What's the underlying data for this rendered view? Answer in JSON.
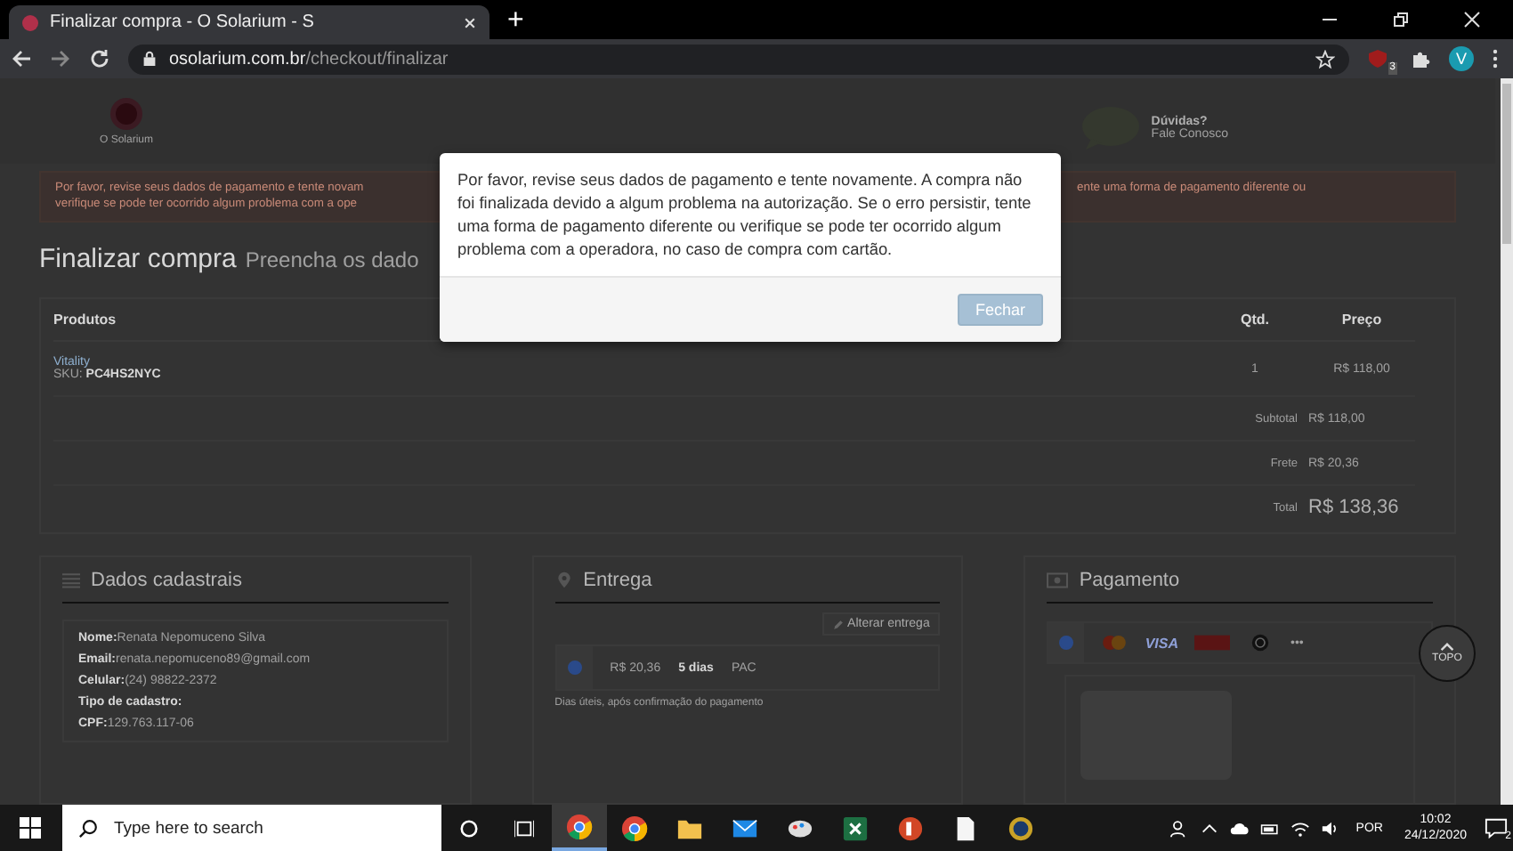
{
  "browser": {
    "tab": {
      "title": "Finalizar compra - O Solarium - S",
      "selected": true
    },
    "new_tab": "+",
    "url_domain": "osolarium.com.br",
    "url_path": "/checkout/finalizar",
    "extension_badge": "3",
    "profile": "V"
  },
  "header": {
    "logo_text": "O Solarium",
    "help_title": "Dúvidas?",
    "help_link": "Fale Conosco"
  },
  "alert": {
    "left_lines": [
      "Por favor, revise seus dados de pagamento e tente novam",
      "verifique se pode ter ocorrido algum problema com a ope"
    ],
    "right_lines": [
      "ente uma forma de pagamento diferente ou"
    ]
  },
  "title": "Finalizar compra",
  "subtitle": "Preencha os dado",
  "products": {
    "columns": [
      "Produtos",
      "Qtd.",
      "Preço"
    ],
    "rows": [
      {
        "name": "Vitality",
        "sku_label": "SKU:",
        "sku": "PC4HS2NYC",
        "qty": "1",
        "price": "R$ 118,00"
      }
    ],
    "totals": [
      {
        "label": "Subtotal",
        "value": "R$ 118,00",
        "kind": "normal"
      },
      {
        "label": "Frete",
        "value": "R$ 20,36",
        "kind": "normal"
      },
      {
        "label": "Total",
        "value": "R$ 138,36",
        "kind": "grand"
      }
    ]
  },
  "customer": {
    "title": "Dados cadastrais",
    "fields": [
      {
        "label": "Nome:",
        "value": "Renata Nepomuceno Silva"
      },
      {
        "label": "Email:",
        "value": "renata.nepomuceno89@gmail.com"
      },
      {
        "label": "Celular:",
        "value": "(24) 98822-2372"
      },
      {
        "label": "Tipo de cadastro:"
      },
      {
        "label": "CPF:",
        "value": "129.763.117-06"
      }
    ]
  },
  "shipping": {
    "title": "Entrega",
    "change_button": "Alterar entrega",
    "options": [
      {
        "price": "R$ 20,36",
        "days": "5 dias",
        "service": "PAC",
        "selected": true
      }
    ],
    "note": "Dias úteis, após confirmação do pagamento"
  },
  "payment": {
    "title": "Pagamento",
    "radio_selected": true,
    "brands": [
      {
        "kind": "mastercard"
      },
      {
        "kind": "visa",
        "label": "VISA"
      },
      {
        "kind": "amex"
      },
      {
        "kind": "diners"
      },
      {
        "kind": "more",
        "label": "•••"
      }
    ]
  },
  "back_to_top": "TOPO",
  "modal": {
    "message": "Por favor, revise seus dados de pagamento e tente novamente. A compra não foi finalizada devido a algum problema na autorização. Se o erro persistir, tente uma forma de pagamento diferente ou verifique se pode ter ocorrido algum problema com a operadora, no caso de compra com cartão.",
    "button": "Fechar"
  },
  "taskbar": {
    "search_placeholder": "Type here to search",
    "apps": [
      {
        "kind": "chrome",
        "active": true
      },
      {
        "kind": "chrome",
        "active": false
      },
      {
        "kind": "folder",
        "active": false
      },
      {
        "kind": "mail",
        "active": false
      },
      {
        "kind": "paint",
        "active": false
      },
      {
        "kind": "excel",
        "active": false
      },
      {
        "kind": "powerpoint",
        "active": false
      },
      {
        "kind": "document",
        "active": false
      },
      {
        "kind": "game",
        "active": false
      }
    ],
    "language": "POR",
    "time": "10:02",
    "date": "24/12/2020",
    "notifications": "2"
  }
}
